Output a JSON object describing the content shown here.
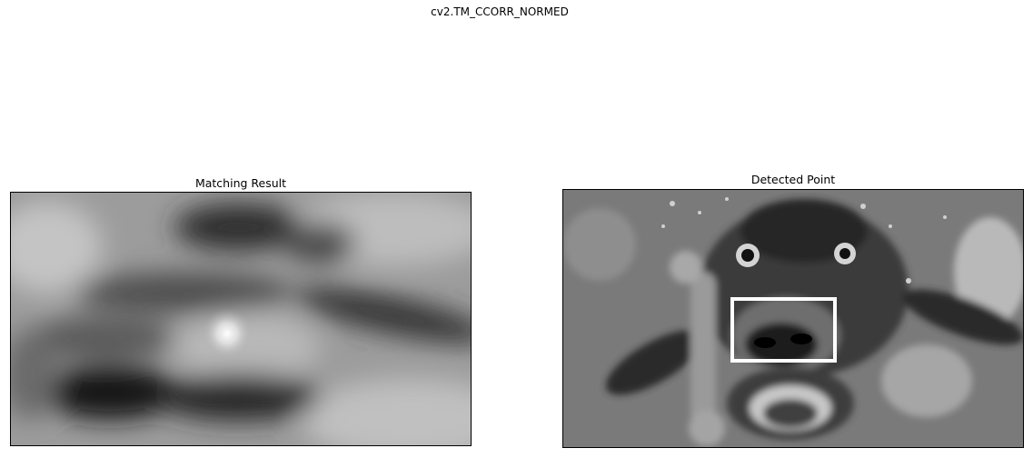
{
  "figure": {
    "suptitle": "cv2.TM_CCORR_NORMED"
  },
  "subplots": [
    {
      "title": "Matching Result"
    },
    {
      "title": "Detected Point"
    }
  ],
  "colors": {
    "background": "#ffffff",
    "rectangle": "#ffffff"
  }
}
